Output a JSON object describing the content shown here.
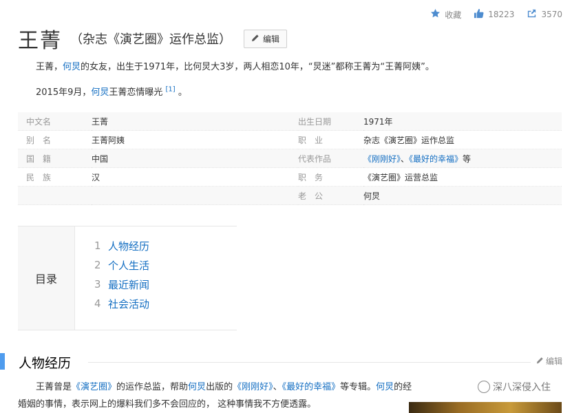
{
  "actions": {
    "favorite_label": "收藏",
    "likes": "18223",
    "shares": "3570"
  },
  "header": {
    "title": "王菁",
    "subtitle": "（杂志《演艺圈》运作总监）",
    "edit_label": "编辑"
  },
  "intro": {
    "p1_a": "王菁，",
    "p1_link": "何炅",
    "p1_b": "的女友，出生于1971年，比何炅大3岁，两人相恋10年，“炅迷”都称王菁为“王菁阿姨”。",
    "p2_a": "2015年9月，",
    "p2_link": "何炅",
    "p2_b": "王菁恋情曝光",
    "p2_ref": "[1]",
    "p2_c": "。"
  },
  "info": {
    "left": [
      {
        "label": "中文名",
        "value": "王菁"
      },
      {
        "label": "别　名",
        "value": "王菁阿姨"
      },
      {
        "label": "国　籍",
        "value": "中国"
      },
      {
        "label": "民　族",
        "value": "汉"
      }
    ],
    "right": [
      {
        "label": "出生日期",
        "value": "1971年"
      },
      {
        "label": "职　业",
        "value": "杂志《演艺圈》运作总监"
      },
      {
        "label": "代表作品",
        "value_a": "《刚刚好》",
        "value_sep": "、",
        "value_b": "《最好的幸福》",
        "value_c": "等"
      },
      {
        "label": "职　务",
        "value": "《演艺圈》运营总监"
      },
      {
        "label": "老　公",
        "value": "何炅"
      }
    ]
  },
  "toc": {
    "heading": "目录",
    "items": [
      {
        "num": "1",
        "text": "人物经历"
      },
      {
        "num": "2",
        "text": "个人生活"
      },
      {
        "num": "3",
        "text": "最近新闻"
      },
      {
        "num": "4",
        "text": "社会活动"
      }
    ]
  },
  "section": {
    "title": "人物经历",
    "edit_label": "编辑",
    "body1_a": "王菁曾是",
    "body1_l1": "《演艺圈》",
    "body1_b": "的运作总监，帮助",
    "body1_l2": "何炅",
    "body1_c": "出版的",
    "body1_l3": "《刚刚好》",
    "body1_d": "、",
    "body1_l4": "《最好的幸福》",
    "body1_e": "等专辑。",
    "body1_l5": "何炅",
    "body1_f": "的经",
    "body2": "婚姻的事情，表示网上的爆料我们多不会回应的， 这种事情我不方便透露。"
  },
  "watermark": "深八深侵入住"
}
